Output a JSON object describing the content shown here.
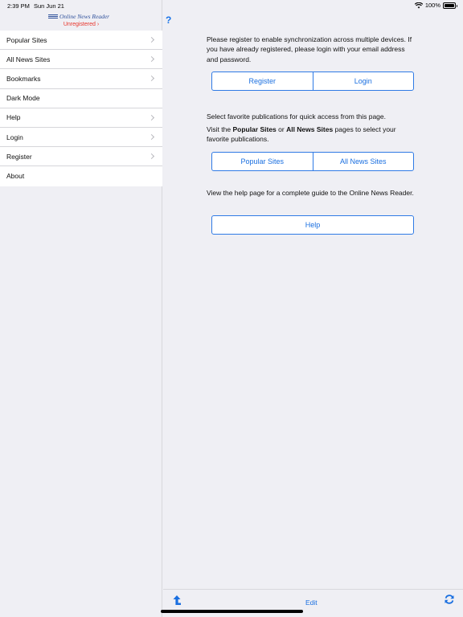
{
  "status_bar": {
    "time": "2:39 PM",
    "date": "Sun Jun 21",
    "battery": "100%"
  },
  "sidebar": {
    "logo_text": "Online News Reader",
    "registration_status": "Unregistered ›",
    "items": [
      {
        "label": "Popular Sites",
        "chevron": true
      },
      {
        "label": "All News Sites",
        "chevron": true
      },
      {
        "label": "Bookmarks",
        "chevron": true
      },
      {
        "label": "Dark Mode",
        "chevron": false
      },
      {
        "label": "Help",
        "chevron": true
      },
      {
        "label": "Login",
        "chevron": true
      },
      {
        "label": "Register",
        "chevron": true
      },
      {
        "label": "About",
        "chevron": false
      }
    ]
  },
  "main": {
    "help_symbol": "?",
    "register_text": "Please register to enable synchronization across multiple devices. If you have already registered, please login with your email address and password.",
    "register_button": "Register",
    "login_button": "Login",
    "favorites_text": "Select favorite publications for quick access from this page.",
    "visit_prefix": "Visit the ",
    "visit_bold1": "Popular Sites",
    "visit_or": " or ",
    "visit_bold2": "All News Sites",
    "visit_suffix": " pages to select your favorite publications.",
    "popular_button": "Popular Sites",
    "all_button": "All News Sites",
    "help_text": "View the help page for a complete guide to the Online News Reader.",
    "help_button": "Help"
  },
  "toolbar": {
    "edit_label": "Edit"
  },
  "colors": {
    "accent": "#1a6fe0",
    "warning": "#e8352c",
    "logo": "#2d4f9a"
  }
}
